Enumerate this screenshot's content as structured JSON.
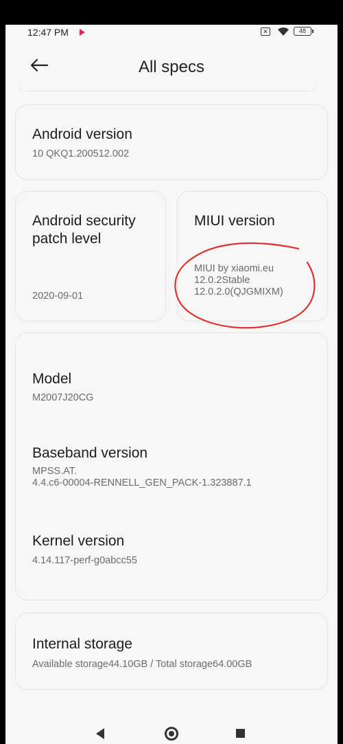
{
  "status_bar": {
    "time": "12:47 PM",
    "battery": "48",
    "sim_icon": "sim-x-icon",
    "wifi_icon": "wifi-icon"
  },
  "header": {
    "title": "All specs",
    "back_icon": "arrow-left-icon"
  },
  "specs": {
    "android_version": {
      "label": "Android version",
      "value": "10 QKQ1.200512.002"
    },
    "security_patch": {
      "label": "Android security patch level",
      "value": "2020-09-01"
    },
    "miui_version": {
      "label": "MIUI version",
      "value_line1": "MIUI by xiaomi.eu",
      "value_line2": "12.0.2Stable",
      "value_line3": "12.0.2.0(QJGMIXM)"
    },
    "model": {
      "label": "Model",
      "value": "M2007J20CG"
    },
    "baseband": {
      "label": "Baseband version",
      "value_line1": "MPSS.AT.",
      "value_line2": "4.4.c6-00004-RENNELL_GEN_PACK-1.323887.1"
    },
    "kernel": {
      "label": "Kernel version",
      "value": "4.14.117-perf-g0abcc55"
    },
    "storage": {
      "label": "Internal storage",
      "value": "Available storage44.10GB / Total storage64.00GB"
    }
  },
  "annotation": {
    "color": "#e0312c"
  },
  "navbar": {
    "back_icon": "triangle-back-icon",
    "home_icon": "circle-home-icon",
    "recents_icon": "square-recents-icon"
  }
}
